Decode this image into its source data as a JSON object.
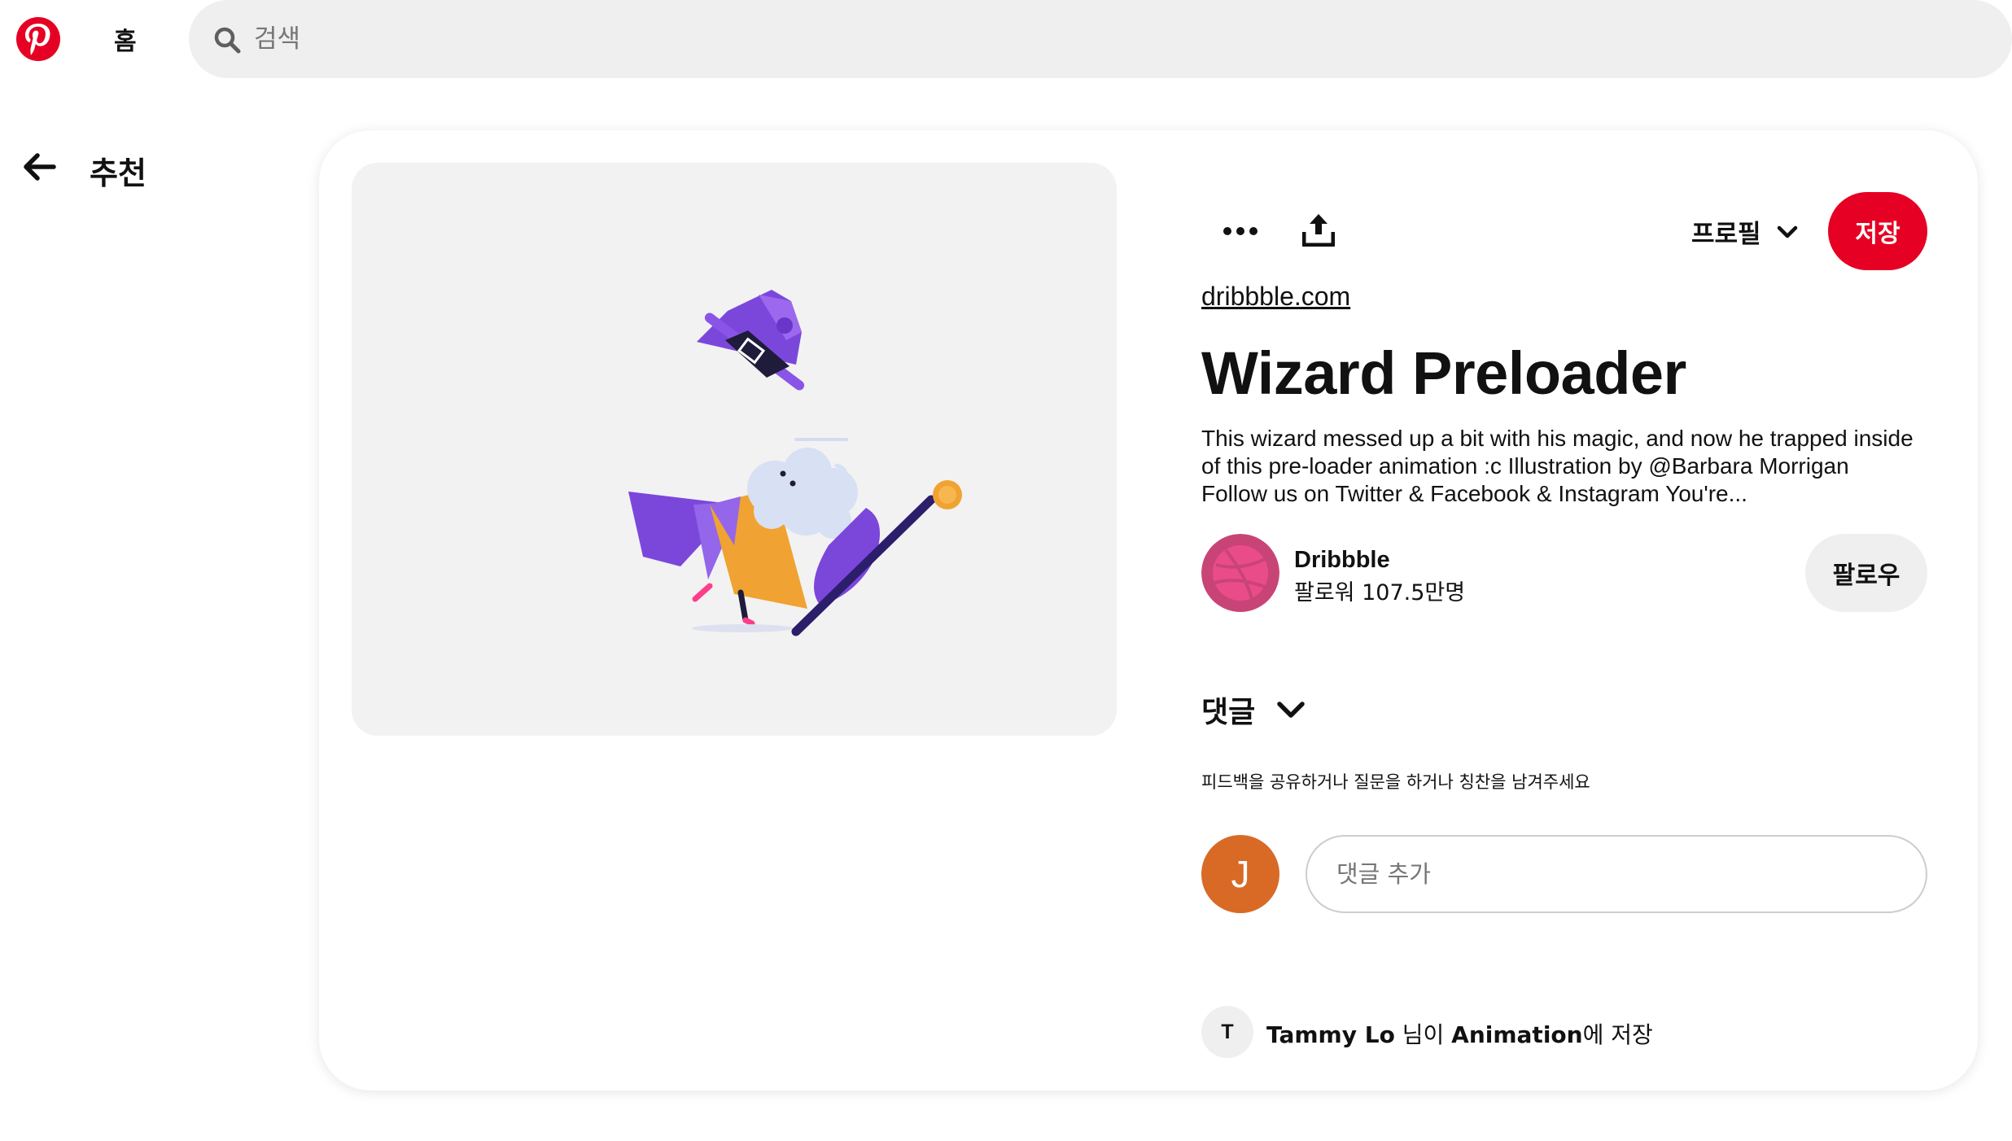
{
  "nav": {
    "home_label": "홈",
    "search_placeholder": "검색",
    "brand_color": "#e60023"
  },
  "back": {
    "title": "추천"
  },
  "pin": {
    "source": "dribbble.com",
    "title": "Wizard Preloader",
    "description": "This wizard messed up a bit with his magic, and now he trapped inside of this pre-loader animation :c Illustration by @Barbara Morrigan Follow us on Twitter & Facebook & Instagram You're...",
    "profile_select": "프로필",
    "save_label": "저장"
  },
  "creator": {
    "name": "Dribbble",
    "followers": "팔로워 107.5만명",
    "follow_label": "팔로우"
  },
  "comments": {
    "title": "댓글",
    "hint": "피드백을 공유하거나 질문을 하거나 칭찬을 남겨주세요",
    "user_initial": "J",
    "input_placeholder": "댓글 추가"
  },
  "saved_by": {
    "initial": "T",
    "user": "Tammy Lo",
    "middle": " 님이 ",
    "board": "Animation",
    "suffix": "에 저장"
  },
  "icons": {
    "logo": "pinterest-logo-icon",
    "search": "search-icon",
    "back": "arrow-left-icon",
    "more": "ellipsis-icon",
    "share": "share-upload-icon",
    "chevron": "chevron-down-icon"
  }
}
